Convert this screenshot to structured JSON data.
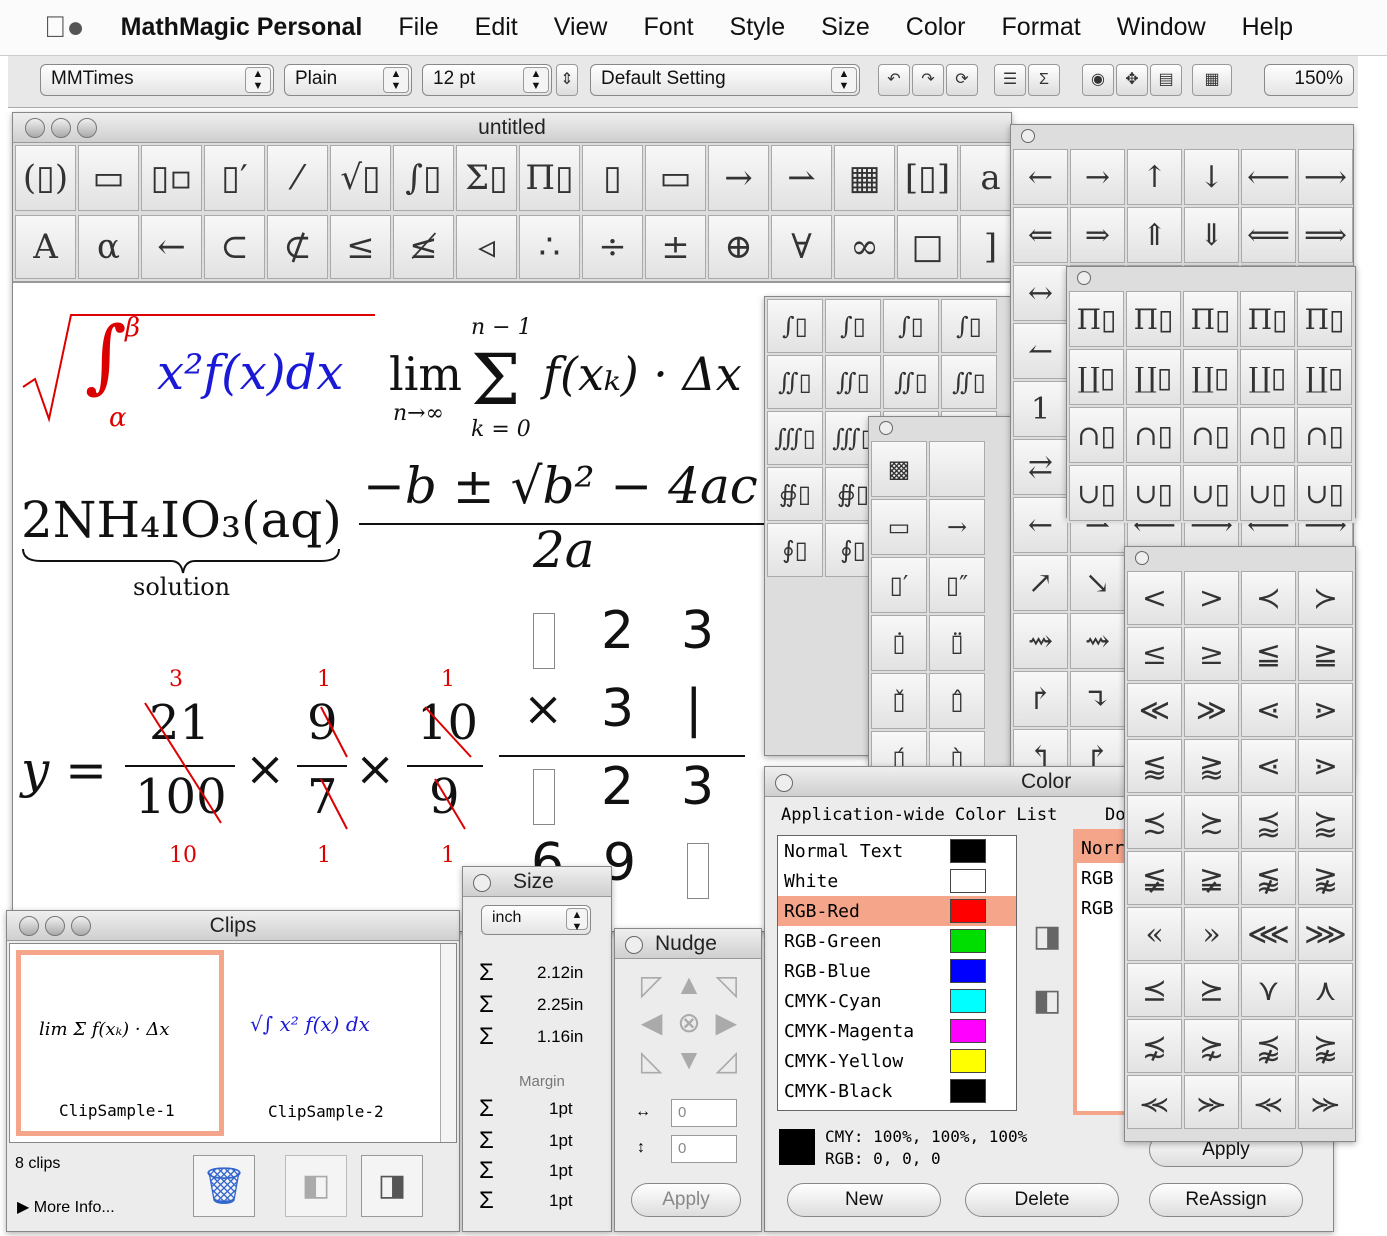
{
  "menubar": {
    "app": "MathMagic Personal",
    "items": [
      "File",
      "Edit",
      "View",
      "Font",
      "Style",
      "Size",
      "Color",
      "Format",
      "Window",
      "Help"
    ]
  },
  "toolbar": {
    "font": "MMTimes",
    "style": "Plain",
    "size": "12 pt",
    "setting": "Default Setting",
    "zoom": "150%"
  },
  "doc": {
    "title": "untitled"
  },
  "palette_top": [
    "(▯)",
    "▭",
    "▯▫",
    "▯′",
    "⁄",
    "√▯",
    "∫▯",
    "Σ▯",
    "Π▯",
    "▯",
    "▭",
    "→",
    "⇀",
    "▦",
    "[▯]",
    "a"
  ],
  "palette_bottom": [
    "A",
    "α",
    "←",
    "⊂",
    "⊄",
    "≤",
    "≰",
    "◃",
    "∴",
    "÷",
    "±",
    "⊕",
    "∀",
    "∞",
    "□",
    "]"
  ],
  "equations": {
    "sqrt_integral": "x²f(x)dx",
    "int_lower": "α",
    "int_upper": "β",
    "lim": "lim",
    "lim_sub": "n→∞",
    "sum_upper": "n − 1",
    "sum_lower": "k = 0",
    "sum_body": "f(xₖ) · Δx",
    "chem": "2NH₄IO₃(aq)",
    "brace_label": "solution",
    "quad_num": "−b ± √b² − 4ac",
    "quad_den": "2a",
    "y_lhs": "y =",
    "frac1_num": "21",
    "frac1_den": "100",
    "frac1_num_red": "3",
    "frac1_den_red": "10",
    "frac2_num": "9",
    "frac2_den": "7",
    "frac2_num_red": "1",
    "frac2_den_red": "1",
    "frac3_num": "10",
    "frac3_den": "9",
    "frac3_num_red": "1",
    "frac3_den_red": "1",
    "long_row1": [
      "2",
      "3"
    ],
    "long_row2": [
      "3",
      "|"
    ],
    "long_row3": [
      "2",
      "3"
    ],
    "long_row4": [
      "6",
      "9"
    ]
  },
  "clips": {
    "title": "Clips",
    "count": "8 clips",
    "more": "More Info...",
    "items": [
      "ClipSample-1",
      "ClipSample-2"
    ]
  },
  "size": {
    "title": "Size",
    "unit": "inch",
    "values": [
      "2.12in",
      "2.25in",
      "1.16in"
    ],
    "margin_label": "Margin",
    "margins": [
      "1pt",
      "1pt",
      "1pt",
      "1pt"
    ]
  },
  "nudge": {
    "title": "Nudge",
    "h": "0",
    "v": "0",
    "apply": "Apply"
  },
  "color": {
    "title": "Color",
    "list_label": "Application-wide Color List",
    "doc_label": "Do",
    "items": [
      {
        "name": "Normal Text",
        "hex": "#000000"
      },
      {
        "name": "White",
        "hex": "#ffffff"
      },
      {
        "name": "RGB-Red",
        "hex": "#ff0000"
      },
      {
        "name": "RGB-Green",
        "hex": "#00dd00"
      },
      {
        "name": "RGB-Blue",
        "hex": "#0000ff"
      },
      {
        "name": "CMYK-Cyan",
        "hex": "#00ffff"
      },
      {
        "name": "CMYK-Magenta",
        "hex": "#ff00ff"
      },
      {
        "name": "CMYK-Yellow",
        "hex": "#ffff00"
      },
      {
        "name": "CMYK-Black",
        "hex": "#000000"
      }
    ],
    "doc_items": [
      "Norr",
      "RGB",
      "RGB"
    ],
    "cmy": "CMY: 100%, 100%, 100%",
    "rgb": "RGB: 0, 0, 0",
    "apply": "Apply",
    "new": "New",
    "delete": "Delete",
    "reassign": "ReAssign"
  },
  "arrows": [
    "←",
    "→",
    "↑",
    "↓",
    "⟵",
    "⟶",
    "⇐",
    "⇒",
    "⇑",
    "⇓",
    "⟸",
    "⟹",
    "↔",
    "",
    "",
    "",
    "",
    "",
    "↼",
    "",
    "",
    "",
    "",
    "",
    "1",
    "",
    "",
    "",
    "",
    "",
    "⇄",
    "",
    "",
    "",
    "",
    "",
    "←",
    "⇀",
    "⟵",
    "⟶",
    "⟵",
    "⟶",
    "↗",
    "↘",
    "",
    "",
    "",
    "",
    "⇝",
    "⇝",
    "",
    "",
    "",
    "",
    "↱",
    "↴",
    "",
    "",
    "",
    "",
    "↰",
    "↱",
    "",
    "",
    "",
    ""
  ],
  "prod_palette": [
    "Π▯",
    "Π▯",
    "Π▯",
    "Π▯",
    "Π▯",
    "∐▯",
    "∐▯",
    "∐▯",
    "∐▯",
    "∐▯",
    "∩▯",
    "∩▯",
    "∩▯",
    "∩▯",
    "∩▯",
    "∪▯",
    "∪▯",
    "∪▯",
    "∪▯",
    "∪▯"
  ],
  "rel_palette": [
    "<",
    ">",
    "≺",
    "≻",
    "≤",
    "≥",
    "≦",
    "≧",
    "≪",
    "≫",
    "⋖",
    "⋗",
    "⪅",
    "⪆",
    "⋖",
    "⋗",
    "≾",
    "≿",
    "⪷",
    "⪸",
    "≨",
    "≩",
    "⪉",
    "⪊",
    "«",
    "»",
    "⋘",
    "⋙",
    "⪯",
    "⪰",
    "⋎",
    "⋏",
    "⋨",
    "⋩",
    "⪹",
    "⪺",
    "⪻",
    "⪼",
    "⪻",
    "⪼"
  ],
  "int_palette": [
    "∫▯",
    "∫▯",
    "∫▯",
    "∫▯",
    "∬▯",
    "∬▯",
    "∬▯",
    "∬▯",
    "∭▯",
    "∭▯",
    "∮▯",
    "∮▯",
    "∯▯",
    "∯▯",
    "∰▯",
    "∰▯",
    "∮▯",
    "∮▯",
    "∮▯",
    "∮▯"
  ],
  "accent_palette": [
    "▩",
    "",
    "▭",
    "→",
    "▯′",
    "▯″",
    "▯̇",
    "▯̈",
    "▯̌",
    "▯̂",
    "▯́",
    "▯̀"
  ]
}
